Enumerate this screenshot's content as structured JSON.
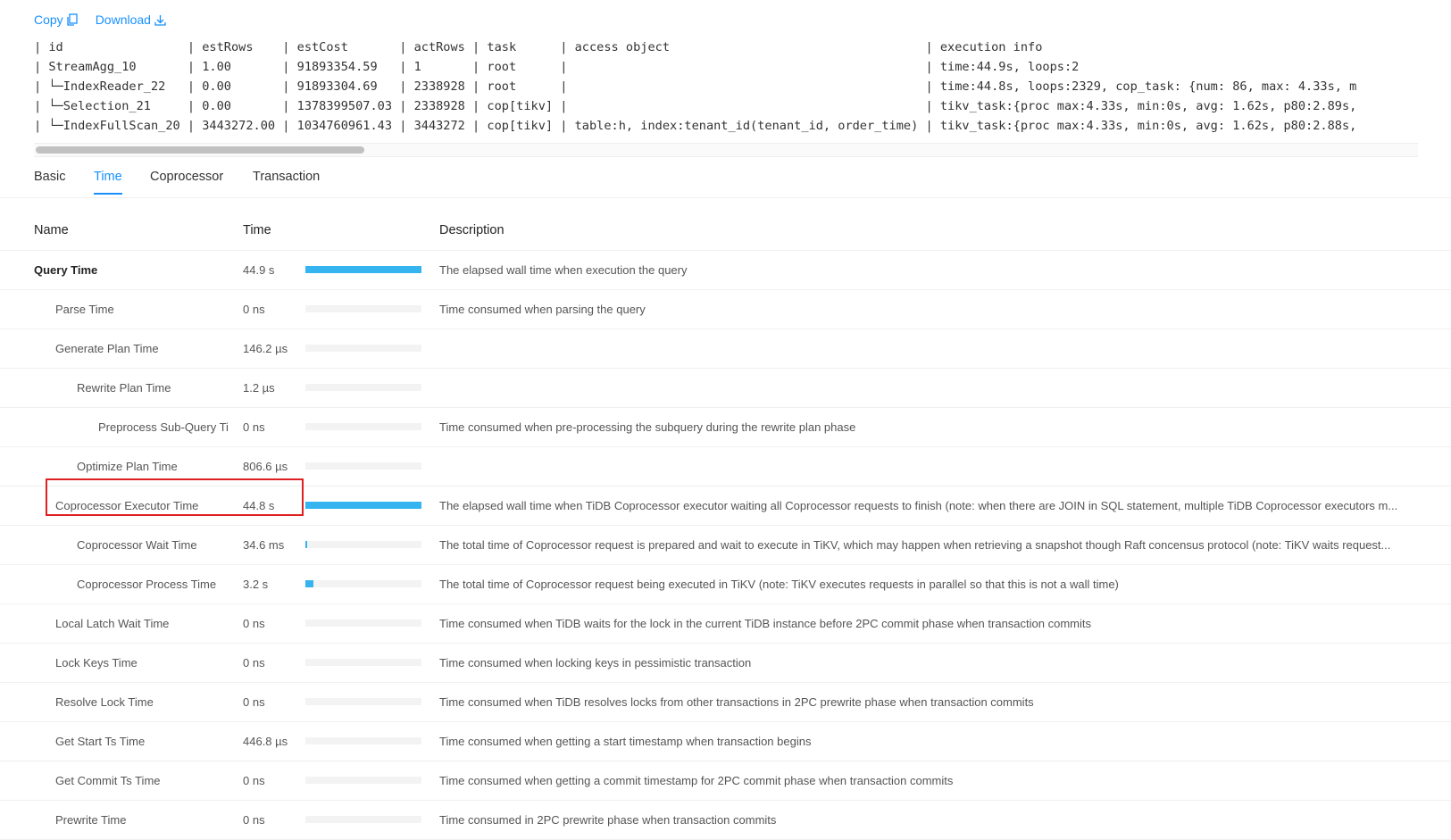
{
  "actions": {
    "copy_label": "Copy",
    "download_label": "Download"
  },
  "plan_lines": [
    "| id                  | estRows    | estCost       | actRows | task      | access object                              | execution info",
    "| StreamAgg_10        | 1.00       | 91893354.59   | 1       | root      |                                            | time:44.9s, loops:2",
    "| └─IndexReader_22    | 0.00       | 91893304.69   | 2338928 | root      |                                            | time:44.8s, loops:2329, cop_task: {num: 86, max: 4.33s, m",
    "|   └─Selection_21    | 0.00       | 1378399507.03 | 2338928 | cop[tikv] |                                            | tikv_task:{proc max:4.33s, min:0s, avg: 1.62s, p80:2.89s,",
    "|     └─IndexFullScan_20 | 3443272.00 | 1034760961.43 | 3443272 | cop[tikv] | table:h, index:tenant_id(tenant_id, order_time) | tikv_task:{proc max:4.33s, min:0s, avg: 1.62s, p80:2.88s,"
  ],
  "tabs": [
    "Basic",
    "Time",
    "Coprocessor",
    "Transaction"
  ],
  "active_tab": "Time",
  "table": {
    "headers": {
      "name": "Name",
      "time": "Time",
      "description": "Description"
    },
    "rows": [
      {
        "name": "Query Time",
        "time": "44.9 s",
        "fraction": 1.0,
        "indent": 0,
        "bold": true,
        "description": "The elapsed wall time when execution the query"
      },
      {
        "name": "Parse Time",
        "time": "0 ns",
        "fraction": 0,
        "indent": 1,
        "description": "Time consumed when parsing the query"
      },
      {
        "name": "Generate Plan Time",
        "time": "146.2 µs",
        "fraction": 0,
        "indent": 1,
        "description": ""
      },
      {
        "name": "Rewrite Plan Time",
        "time": "1.2 µs",
        "fraction": 0,
        "indent": 2,
        "description": ""
      },
      {
        "name": "Preprocess Sub-Query Ti",
        "time": "0 ns",
        "fraction": 0,
        "indent": 3,
        "description": "Time consumed when pre-processing the subquery during the rewrite plan phase"
      },
      {
        "name": "Optimize Plan Time",
        "time": "806.6 µs",
        "fraction": 0,
        "indent": 2,
        "description": ""
      },
      {
        "name": "Coprocessor Executor Time",
        "time": "44.8 s",
        "fraction": 0.998,
        "indent": 1,
        "description": "The elapsed wall time when TiDB Coprocessor executor waiting all Coprocessor requests to finish (note: when there are JOIN in SQL statement, multiple TiDB Coprocessor executors m..."
      },
      {
        "name": "Coprocessor Wait Time",
        "time": "34.6 ms",
        "fraction": 0.008,
        "indent": 2,
        "description": "The total time of Coprocessor request is prepared and wait to execute in TiKV, which may happen when retrieving a snapshot though Raft concensus protocol (note: TiKV waits request..."
      },
      {
        "name": "Coprocessor Process Time",
        "time": "3.2 s",
        "fraction": 0.071,
        "indent": 2,
        "description": "The total time of Coprocessor request being executed in TiKV (note: TiKV executes requests in parallel so that this is not a wall time)"
      },
      {
        "name": "Local Latch Wait Time",
        "time": "0 ns",
        "fraction": 0,
        "indent": 1,
        "description": "Time consumed when TiDB waits for the lock in the current TiDB instance before 2PC commit phase when transaction commits"
      },
      {
        "name": "Lock Keys Time",
        "time": "0 ns",
        "fraction": 0,
        "indent": 1,
        "description": "Time consumed when locking keys in pessimistic transaction"
      },
      {
        "name": "Resolve Lock Time",
        "time": "0 ns",
        "fraction": 0,
        "indent": 1,
        "description": "Time consumed when TiDB resolves locks from other transactions in 2PC prewrite phase when transaction commits"
      },
      {
        "name": "Get Start Ts Time",
        "time": "446.8 µs",
        "fraction": 0,
        "indent": 1,
        "description": "Time consumed when getting a start timestamp when transaction begins"
      },
      {
        "name": "Get Commit Ts Time",
        "time": "0 ns",
        "fraction": 0,
        "indent": 1,
        "description": "Time consumed when getting a commit timestamp for 2PC commit phase when transaction commits"
      },
      {
        "name": "Prewrite Time",
        "time": "0 ns",
        "fraction": 0,
        "indent": 1,
        "description": "Time consumed in 2PC prewrite phase when transaction commits"
      }
    ]
  },
  "colors": {
    "accent": "#1890ff",
    "bar": "#35b4f0",
    "highlight": "#e02020"
  }
}
